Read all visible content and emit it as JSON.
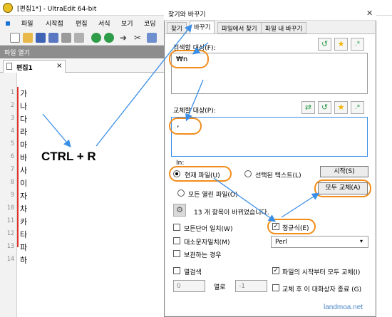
{
  "window": {
    "title": "[편집1*] - UltraEdit 64-bit"
  },
  "menu": [
    "파일",
    "시작점",
    "편집",
    "서식",
    "보기",
    "코딩"
  ],
  "toolbar_icons": [
    "new-file-icon",
    "open-folder-icon",
    "save-icon",
    "save-all-icon",
    "print-icon",
    "print-preview-icon",
    "back-icon",
    "forward-icon",
    "cut-icon",
    "copy-icon"
  ],
  "open_panel": {
    "label": "파일 열기"
  },
  "editor_tab": {
    "label": "편집1",
    "close": "×"
  },
  "lines": [
    {
      "n": "1",
      "t": "가"
    },
    {
      "n": "2",
      "t": "나"
    },
    {
      "n": "3",
      "t": "다"
    },
    {
      "n": "4",
      "t": "라"
    },
    {
      "n": "5",
      "t": "마"
    },
    {
      "n": "6",
      "t": "바"
    },
    {
      "n": "7",
      "t": "사"
    },
    {
      "n": "8",
      "t": "이"
    },
    {
      "n": "9",
      "t": "자"
    },
    {
      "n": "10",
      "t": "차"
    },
    {
      "n": "11",
      "t": "카"
    },
    {
      "n": "12",
      "t": "타"
    },
    {
      "n": "13",
      "t": "파"
    },
    {
      "n": "14",
      "t": "하"
    }
  ],
  "annotation": {
    "shortcut": "CTRL + R"
  },
  "dialog": {
    "title": "찾기와 바꾸기",
    "close": "✕",
    "tabs": [
      "찾기",
      "바꾸기",
      "파일에서 찾기",
      "파일 내 바꾸기"
    ],
    "active_tab": "바꾸기",
    "find": {
      "label": "검색할 대상(F):",
      "value": "₩n"
    },
    "replace": {
      "label": "교체할 대상(P):",
      "value": ","
    },
    "in": {
      "label": "In:",
      "current_file": "현재 파일(U)",
      "selected_text": "선택된 텍스트(L)",
      "all_open_files": "모든 열린 파일(O)"
    },
    "start_button": "시작(S)",
    "replace_all_button": "모두 교체(A)",
    "status": "13 개 항목이 바뀌었습니다.",
    "options": {
      "match_whole_word": "모든단어 일치(W)",
      "match_case": "대소문자일치(M)",
      "preserve_case": "보관하는 경우",
      "regex": "정규식(E)",
      "regex_engine": "Perl",
      "column": "열검색",
      "replace_from_top": "파일의 시작부터 모두 교체(I)",
      "close_after_replace": "교체 후 이 대화상자 종료 (G)",
      "column_from": "0",
      "column_sep": "열로",
      "column_to": "-1"
    }
  },
  "watermark": "landmoa.net",
  "colors": {
    "highlight_oval": "#f28c1a",
    "arrow": "#3a8ee6",
    "line_marker": "#e0322a"
  }
}
